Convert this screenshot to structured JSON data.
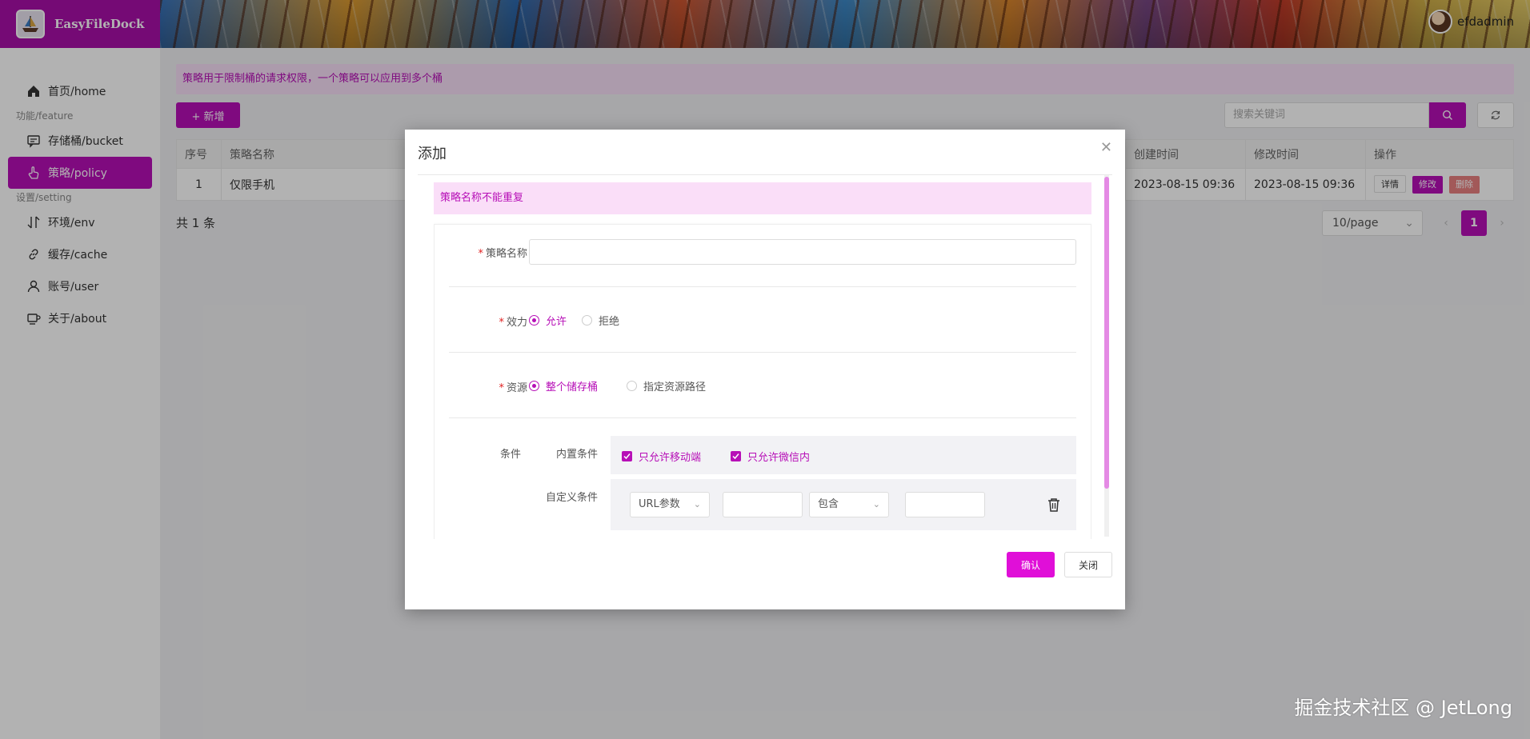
{
  "app": {
    "title": "EasyFileDock",
    "username": "efdadmin"
  },
  "sidebar": {
    "home": "首页/home",
    "group_feature": "功能/feature",
    "bucket": "存储桶/bucket",
    "policy": "策略/policy",
    "group_setting": "设置/setting",
    "env": "环境/env",
    "cache": "缓存/cache",
    "user": "账号/user",
    "about": "关于/about"
  },
  "page": {
    "tip": "策略用于限制桶的请求权限，一个策略可以应用到多个桶",
    "add_button": "+ 新增",
    "search_placeholder": "搜索关键词",
    "table": {
      "headers": [
        "序号",
        "策略名称",
        "创建时间",
        "修改时间",
        "操作"
      ],
      "rows": [
        {
          "index": "1",
          "name": "仅限手机",
          "created": "2023-08-15 09:36",
          "modified": "2023-08-15 09:36"
        }
      ],
      "actions": {
        "detail": "详情",
        "edit": "修改",
        "delete": "删除"
      }
    },
    "total": "共 1 条",
    "page_size": "10/page",
    "current_page": "1"
  },
  "modal": {
    "title": "添加",
    "tip": "策略名称不能重复",
    "name_label": "策略名称",
    "name_value": "",
    "effect_label": "效力",
    "effect_options": [
      "允许",
      "拒绝"
    ],
    "effect_selected": "允许",
    "resource_label": "资源",
    "resource_options": [
      "整个储存桶",
      "指定资源路径"
    ],
    "resource_selected": "整个储存桶",
    "condition_label": "条件",
    "builtin_label": "内置条件",
    "builtin_options": [
      "只允许移动端",
      "只允许微信内"
    ],
    "custom_label": "自定义条件",
    "custom_condition": {
      "type": "URL参数",
      "key": "",
      "op": "包含",
      "value": ""
    },
    "confirm": "确认",
    "close": "关闭"
  },
  "watermark": "掘金技术社区 @ JetLong",
  "colors": {
    "brand": "#b70fb7",
    "header": "#a80fa8",
    "danger": "#e88080",
    "tip_bg": "#f7dff7"
  }
}
